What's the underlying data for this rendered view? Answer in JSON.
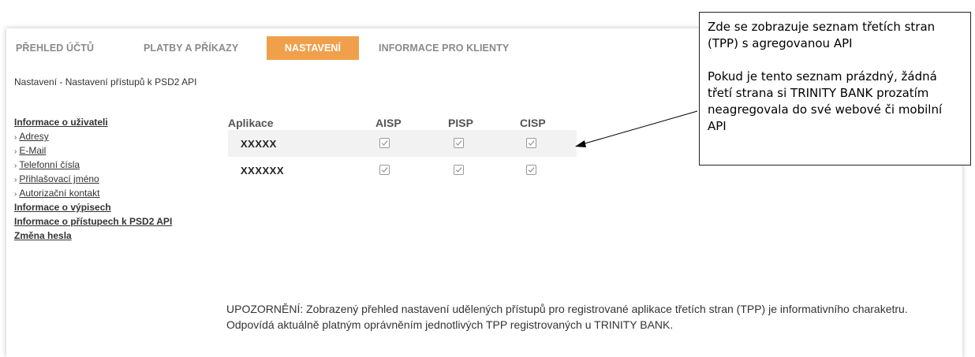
{
  "tabs": [
    {
      "label": "PŘEHLED ÚČTŮ",
      "active": false
    },
    {
      "label": "PLATBY A PŘÍKAZY",
      "active": false
    },
    {
      "label": "NASTAVENÍ",
      "active": true
    },
    {
      "label": "INFORMACE PRO KLIENTY",
      "active": false
    }
  ],
  "breadcrumb": "Nastavení - Nastavení přístupů k PSD2 API",
  "sidebar": {
    "user_info": "Informace o uživateli",
    "sub_items": [
      "Adresy",
      "E-Mail",
      "Telefonní čísla",
      "Přihlašovací jméno",
      "Autorizační kontakt"
    ],
    "statements": "Informace o výpisech",
    "psd2_access": "Informace o přístupech k PSD2 API",
    "password_change": "Změna hesla"
  },
  "table": {
    "headers": [
      "Aplikace",
      "AISP",
      "PISP",
      "CISP"
    ],
    "rows": [
      {
        "name": "XXXXX",
        "aisp": true,
        "pisp": true,
        "cisp": true
      },
      {
        "name": "XXXXXX",
        "aisp": true,
        "pisp": true,
        "cisp": true
      }
    ]
  },
  "notice": "UPOZORNĚNÍ: Zobrazený přehled nastavení udělených přístupů pro registrované aplikace třetích stran (TPP) je informativního charaketru. Odpovídá aktuálně platným oprávněním jednotlivých TPP registrovaných u TRINITY BANK.",
  "callout": {
    "line1": "Zde se zobrazuje seznam třetích stran (TPP) s agregovanou API",
    "line2": "Pokud je tento seznam prázdný, žádná třetí strana si TRINITY BANK prozatím neagregovala do své webové či mobilní API"
  },
  "colors": {
    "accent": "#f0a04b",
    "tab_inactive": "#8a8a8a",
    "row_alt": "#f2f2f2"
  }
}
